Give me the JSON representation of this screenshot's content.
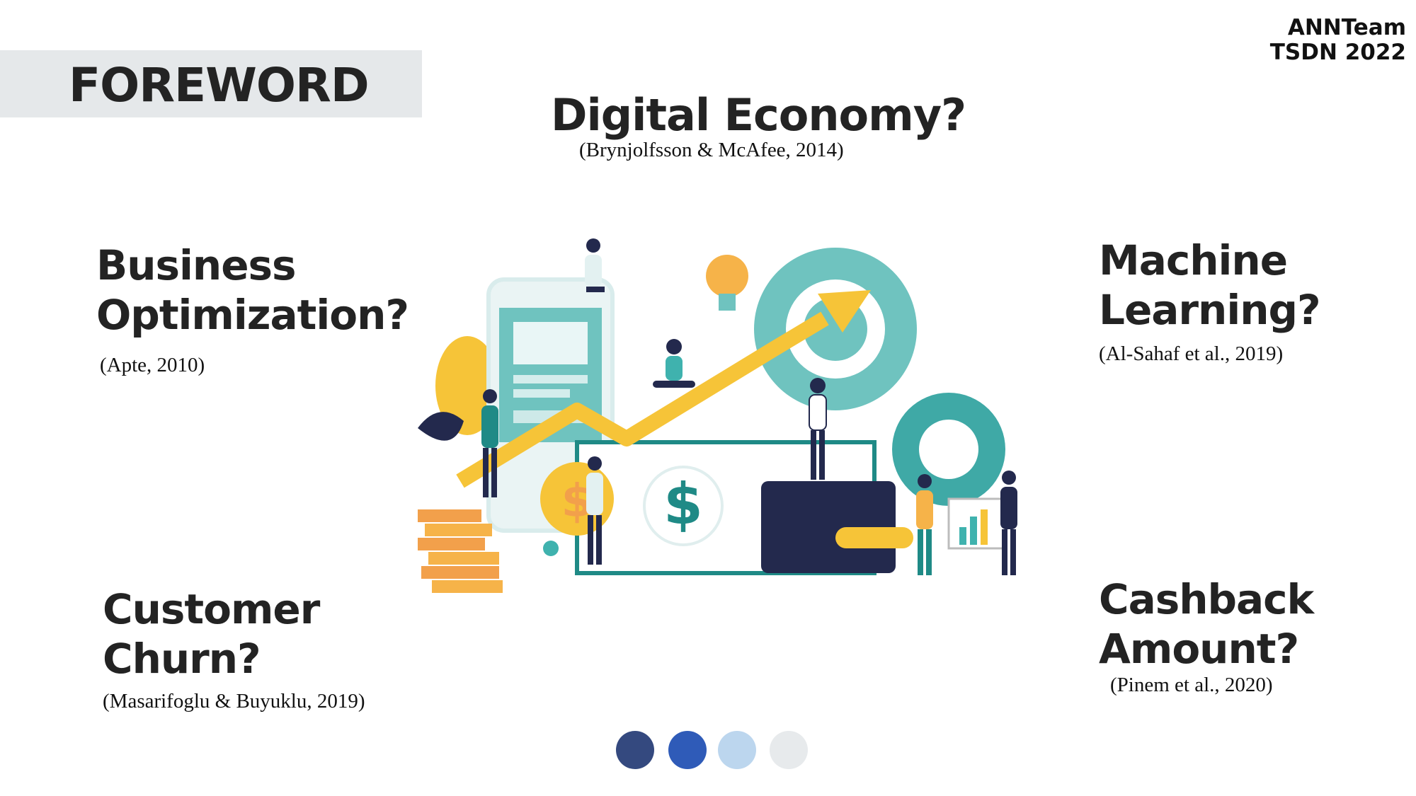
{
  "slide": {
    "title": "FOREWORD",
    "team_line1": "ANNTeam",
    "team_line2": "TSDN 2022"
  },
  "topics": {
    "digital_economy": {
      "title": "Digital Economy?",
      "citation": "(Brynjolfsson & McAfee, 2014)"
    },
    "business_optimization": {
      "line1": "Business",
      "line2": "Optimization?",
      "citation": "(Apte, 2010)"
    },
    "machine_learning": {
      "line1": "Machine",
      "line2": "Learning?",
      "citation": "(Al-Sahaf et al., 2019)"
    },
    "customer_churn": {
      "line1": "Customer",
      "line2": "Churn?",
      "citation": "(Masarifoglu & Buyuklu, 2019)"
    },
    "cashback_amount": {
      "line1": "Cashback",
      "line2": "Amount?",
      "citation": "(Pinem et al., 2020)"
    }
  },
  "illustration": {
    "description_icon": "digital-economy-illustration",
    "currency_symbol": "$"
  },
  "colors": {
    "teal": "#3fb2ae",
    "dark_teal": "#1f8a86",
    "yellow": "#f6c438",
    "orange": "#f2a04b",
    "navy": "#23294d",
    "band_gray": "#e5e8ea",
    "dot_navy": "#34497f",
    "dot_blue": "#2f5bb8",
    "dot_light": "#bcd6ee",
    "dot_gray": "#e7eaec"
  }
}
